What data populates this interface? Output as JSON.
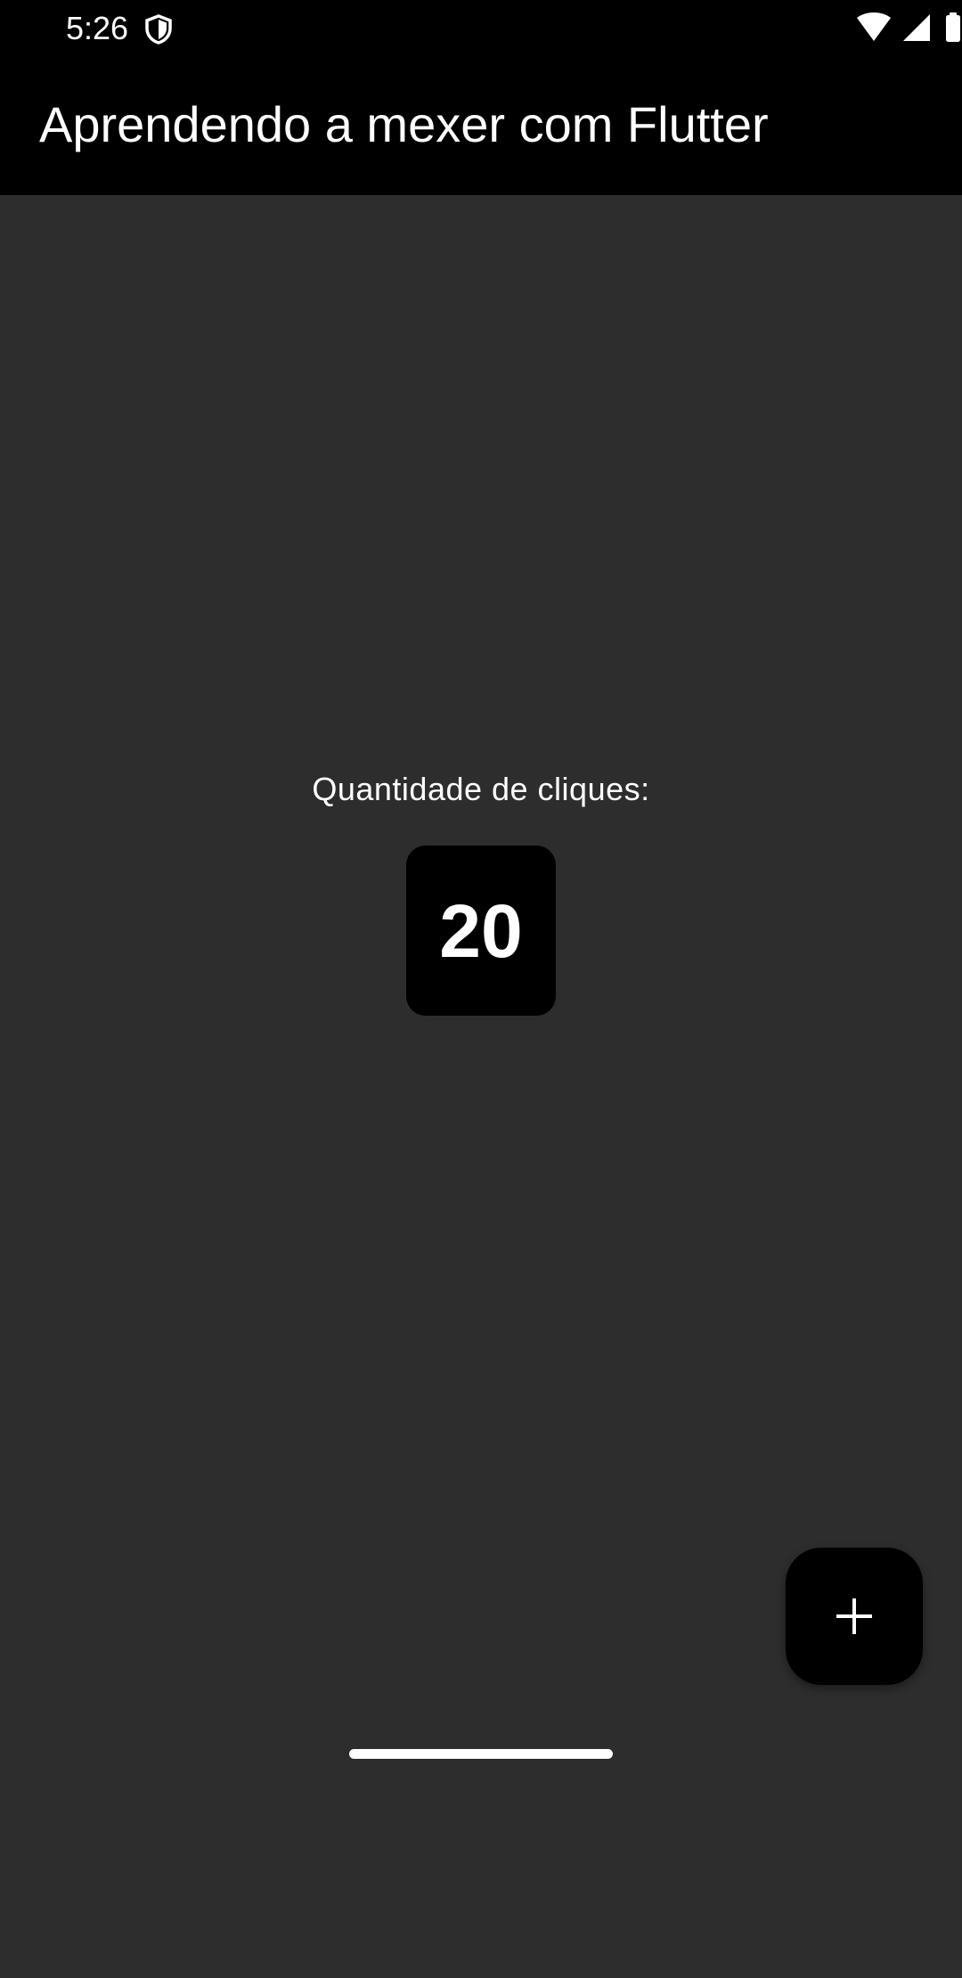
{
  "status_bar": {
    "time": "5:26",
    "icons": [
      "shield-icon",
      "wifi-icon",
      "cell-signal-icon",
      "battery-icon"
    ]
  },
  "app_bar": {
    "title": "Aprendendo a mexer com Flutter"
  },
  "main": {
    "clicks_label": "Quantidade de cliques:",
    "clicks_count": "20"
  },
  "fab": {
    "icon": "plus-icon"
  },
  "colors": {
    "app_bar_bg": "#000000",
    "content_bg": "#2d2d2d",
    "counter_bg": "#000000",
    "text": "#ffffff"
  }
}
